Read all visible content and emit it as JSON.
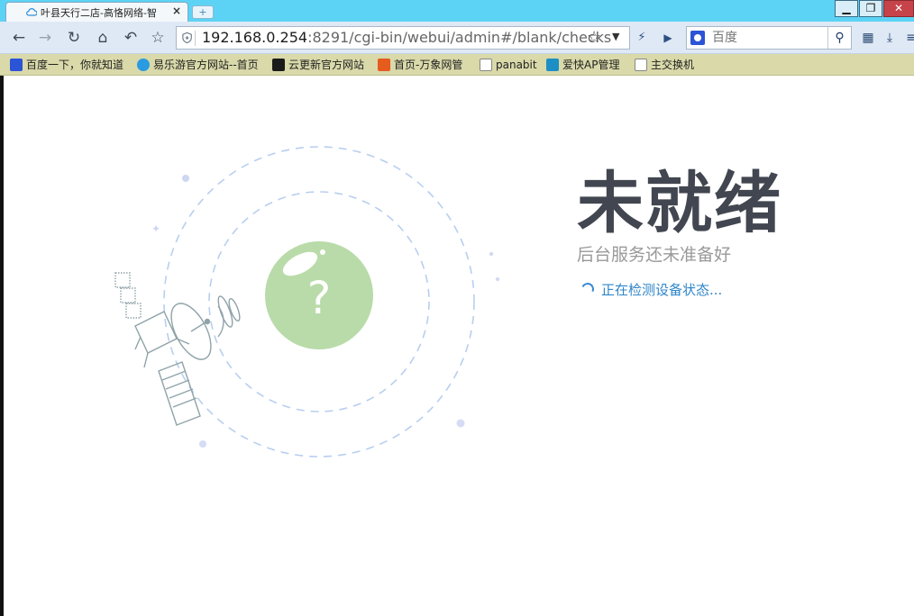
{
  "browser": {
    "tab_title": "叶县天行二店-高恪网络-智",
    "tab_close": "×",
    "new_tab": "+",
    "window_min": "▁",
    "window_max": "❐",
    "window_close": "✕",
    "url_host": "192.168.0.254",
    "url_rest": ":8291/cgi-bin/webui/admin#/blank/checks",
    "search_placeholder": "百度",
    "bookmarks": [
      {
        "label": "百度一下，你就知道",
        "icon": "baidu-paw-icon",
        "color": "#2b54d6"
      },
      {
        "label": "易乐游官方网站--首页",
        "icon": "cloud-icon",
        "color": "#2a9be0"
      },
      {
        "label": "云更新官方网站",
        "icon": "wave-logo-icon",
        "color": "#1b1b1b"
      },
      {
        "label": "首页-万象网管",
        "icon": "w-logo-icon",
        "color": "#e65b1e"
      },
      {
        "label": "panabit",
        "icon": "page-icon",
        "color": "#ffffff"
      },
      {
        "label": "爱快AP管理",
        "icon": "ik-logo-icon",
        "color": "#1d8fc4"
      },
      {
        "label": "主交换机",
        "icon": "page-icon",
        "color": "#ffffff"
      }
    ]
  },
  "page": {
    "title": "未就绪",
    "subtitle": "后台服务还未准备好",
    "checking": "正在检测设备状态...",
    "question_mark": "?",
    "colors": {
      "accent": "#2f86c9",
      "bubble": "#b9dba9",
      "ring": "#b8cff0",
      "title": "#424650"
    }
  }
}
